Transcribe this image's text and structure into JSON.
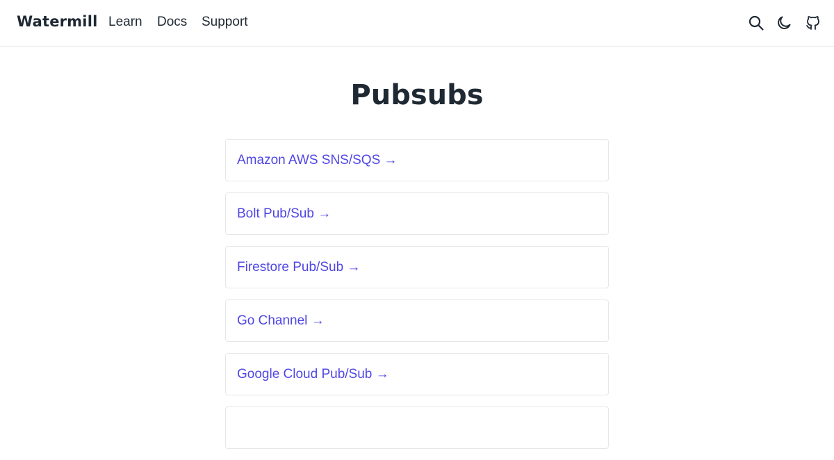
{
  "header": {
    "brand": "Watermill",
    "nav": [
      {
        "label": "Learn"
      },
      {
        "label": "Docs"
      },
      {
        "label": "Support"
      }
    ],
    "icons": [
      "search-icon",
      "moon-icon",
      "github-icon"
    ]
  },
  "main": {
    "title": "Pubsubs",
    "cards": [
      {
        "label": "Amazon AWS SNS/SQS →"
      },
      {
        "label": "Bolt Pub/Sub →"
      },
      {
        "label": "Firestore Pub/Sub →"
      },
      {
        "label": "Go Channel →"
      },
      {
        "label": "Google Cloud Pub/Sub →"
      },
      {
        "label": ""
      }
    ]
  },
  "colors": {
    "link": "#4f46e5",
    "text": "#1f2933",
    "border": "#e5e7eb"
  }
}
